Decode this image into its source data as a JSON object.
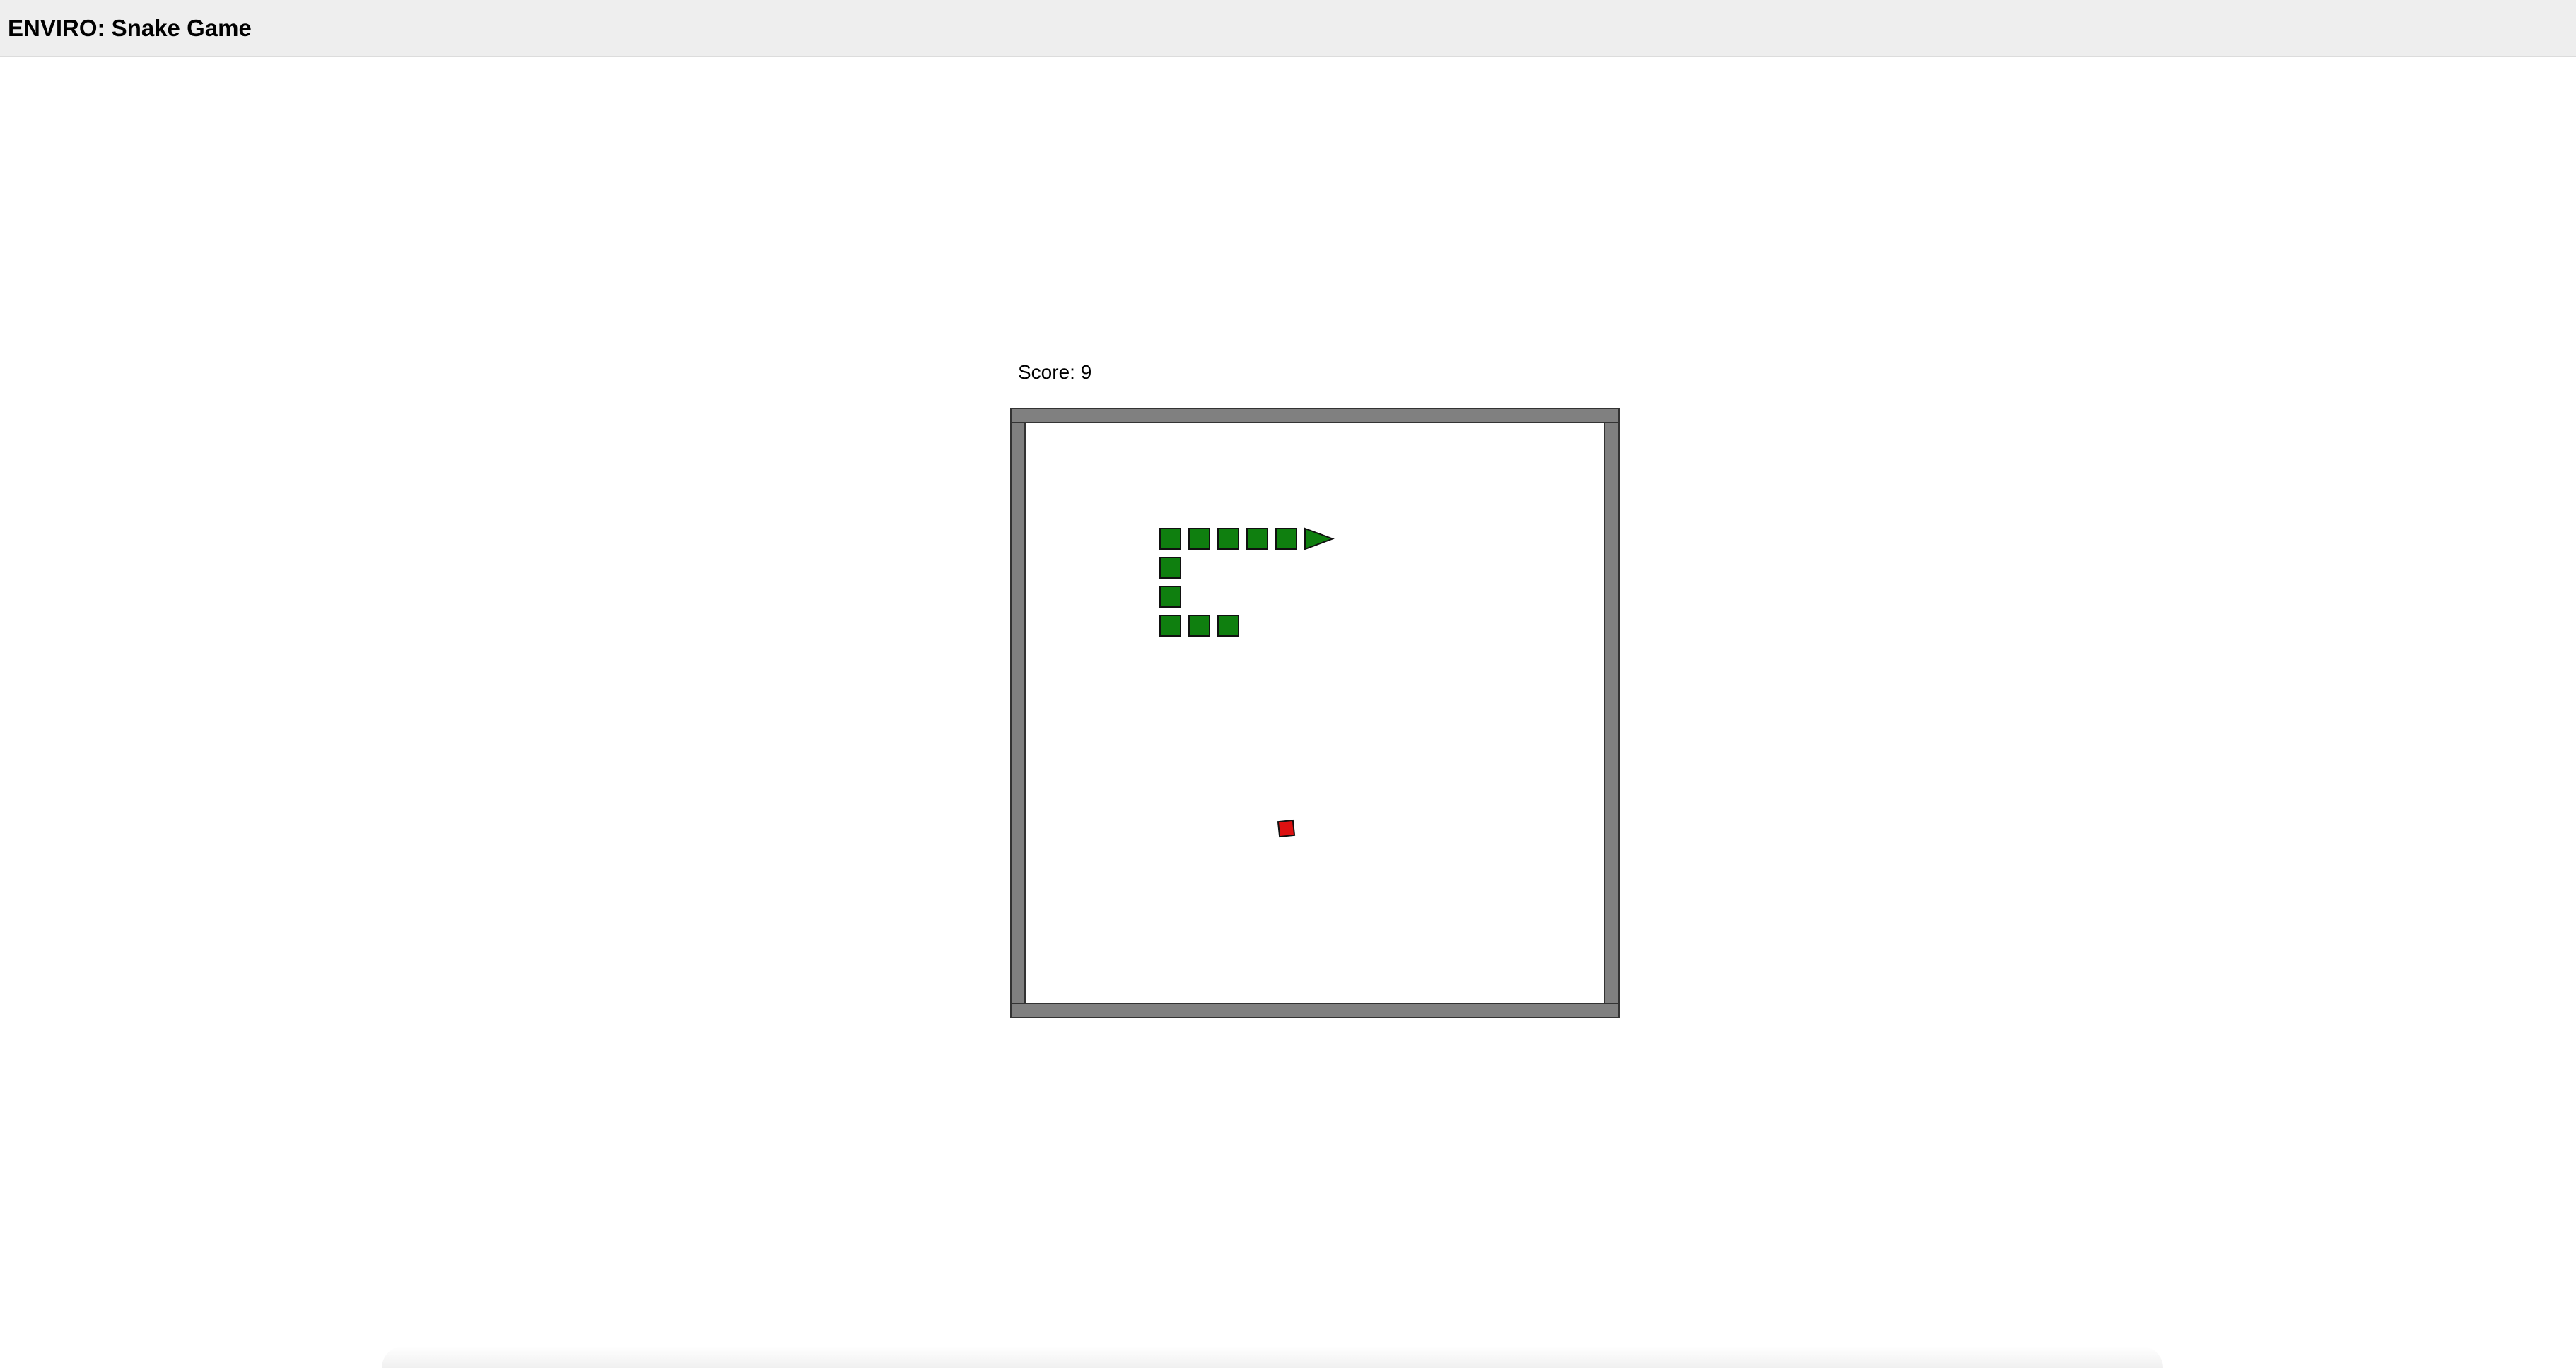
{
  "window": {
    "title": "ENVIRO: Snake Game"
  },
  "game": {
    "score_text": "Score: 9",
    "score": 9,
    "board": {
      "grid_size": 20,
      "wall_color": "#808080",
      "floor_color": "#ffffff"
    },
    "snake": {
      "color": "#0f7f0f",
      "direction": "right",
      "head": {
        "col": 10,
        "row": 4
      },
      "body": [
        {
          "col": 9,
          "row": 4
        },
        {
          "col": 8,
          "row": 4
        },
        {
          "col": 7,
          "row": 4
        },
        {
          "col": 6,
          "row": 4
        },
        {
          "col": 5,
          "row": 4
        },
        {
          "col": 5,
          "row": 5
        },
        {
          "col": 5,
          "row": 6
        },
        {
          "col": 5,
          "row": 7
        },
        {
          "col": 6,
          "row": 7
        },
        {
          "col": 7,
          "row": 7
        }
      ]
    },
    "food": {
      "color": "#dd1111",
      "col": 9,
      "row": 14
    }
  }
}
